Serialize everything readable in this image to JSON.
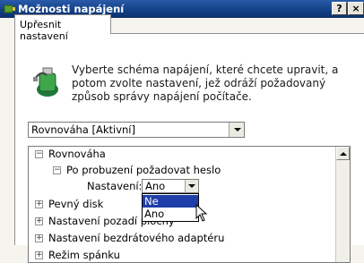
{
  "window": {
    "title": "Možnosti napájení",
    "help_label": "?",
    "close_label": "×"
  },
  "tabs": [
    {
      "label": "Upřesnit nastavení"
    }
  ],
  "intro": {
    "text": "Vyberte schéma napájení, které chcete upravit, a potom zvolte nastavení, jež odráží požadovaný způsob správy napájení počítače."
  },
  "scheme_select": {
    "value": "Rovnováha [Aktivní]"
  },
  "tree": {
    "root": {
      "label": "Rovnováha",
      "expander": "−"
    },
    "child": {
      "label": "Po probuzení požadovat heslo",
      "expander": "−"
    },
    "setting": {
      "label": "Nastavení:",
      "value": "Ano",
      "options": [
        "Ne",
        "Ano"
      ]
    },
    "items": [
      {
        "label": "Pevný disk",
        "expander": "+"
      },
      {
        "label": "Nastavení pozadí plochy",
        "expander": "+"
      },
      {
        "label": "Nastavení bezdrátového adaptéru",
        "expander": "+"
      },
      {
        "label": "Režim spánku",
        "expander": "+"
      }
    ]
  },
  "colors": {
    "titlebar": "#123f86",
    "selection": "#1f3fa8",
    "dialog_bg": "#f5f4ee"
  }
}
